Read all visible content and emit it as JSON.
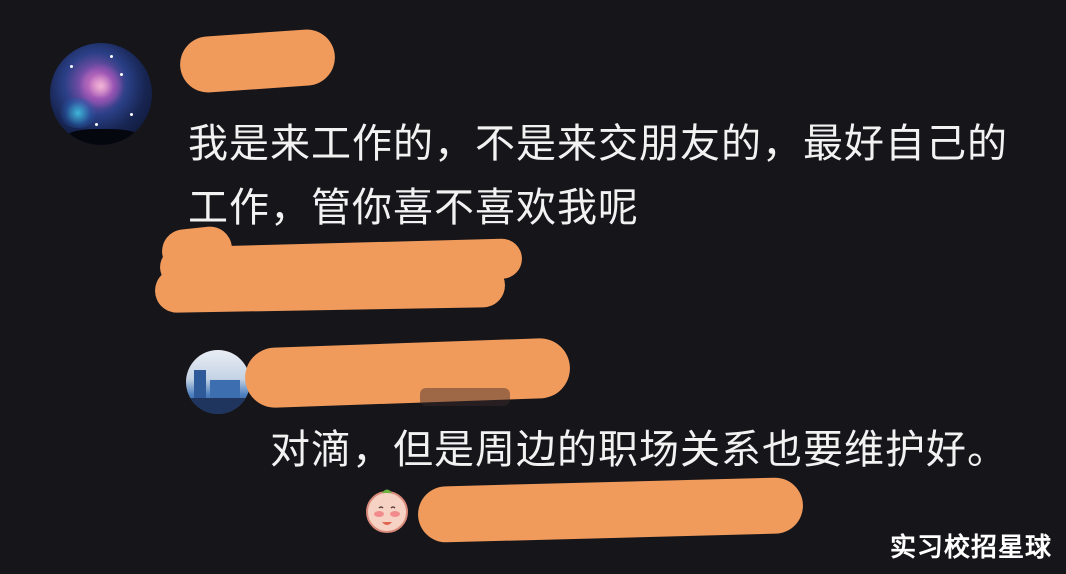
{
  "comment": {
    "text": "我是来工作的，不是来交朋友的，最好自己的工作，管你喜不喜欢我呢"
  },
  "reply": {
    "text": "对滴，但是周边的职场关系也要维护好。"
  },
  "emoji_icon": "blushing-face-emoji",
  "redaction_color": "#f09a5c",
  "watermark": "实习校招星球"
}
